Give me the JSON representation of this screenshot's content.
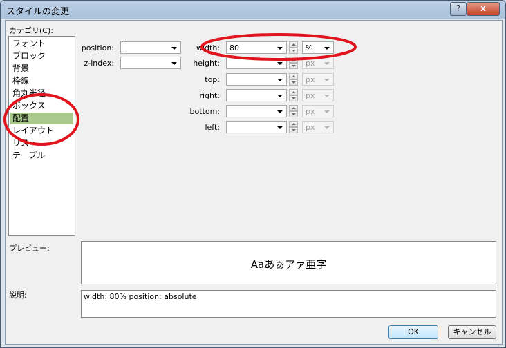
{
  "window": {
    "title": "スタイルの変更",
    "help_label": "?",
    "close_label": "x"
  },
  "category": {
    "label": "カテゴリ(C):",
    "items": [
      "フォント",
      "ブロック",
      "背景",
      "枠線",
      "角丸半径",
      "ボックス",
      "配置",
      "レイアウト",
      "リスト",
      "テーブル"
    ],
    "selected": "配置"
  },
  "fields": {
    "position": {
      "label": "position:",
      "value": ""
    },
    "zindex": {
      "label": "z-index:",
      "value": ""
    },
    "width": {
      "label": "width:",
      "value": "80",
      "unit": "%"
    },
    "height": {
      "label": "height:",
      "value": "",
      "unit": "px"
    },
    "top": {
      "label": "top:",
      "value": "",
      "unit": "px"
    },
    "right": {
      "label": "right:",
      "value": "",
      "unit": "px"
    },
    "bottom": {
      "label": "bottom:",
      "value": "",
      "unit": "px"
    },
    "left": {
      "label": "left:",
      "value": "",
      "unit": "px"
    }
  },
  "preview": {
    "label": "プレビュー:",
    "sample": "Aaあぁアァ亜字"
  },
  "description": {
    "label": "説明:",
    "text": "width: 80% position: absolute"
  },
  "buttons": {
    "ok": "OK",
    "cancel": "キャンセル"
  },
  "colors": {
    "selection": "#a9c98d",
    "annotation": "#e0141c"
  }
}
